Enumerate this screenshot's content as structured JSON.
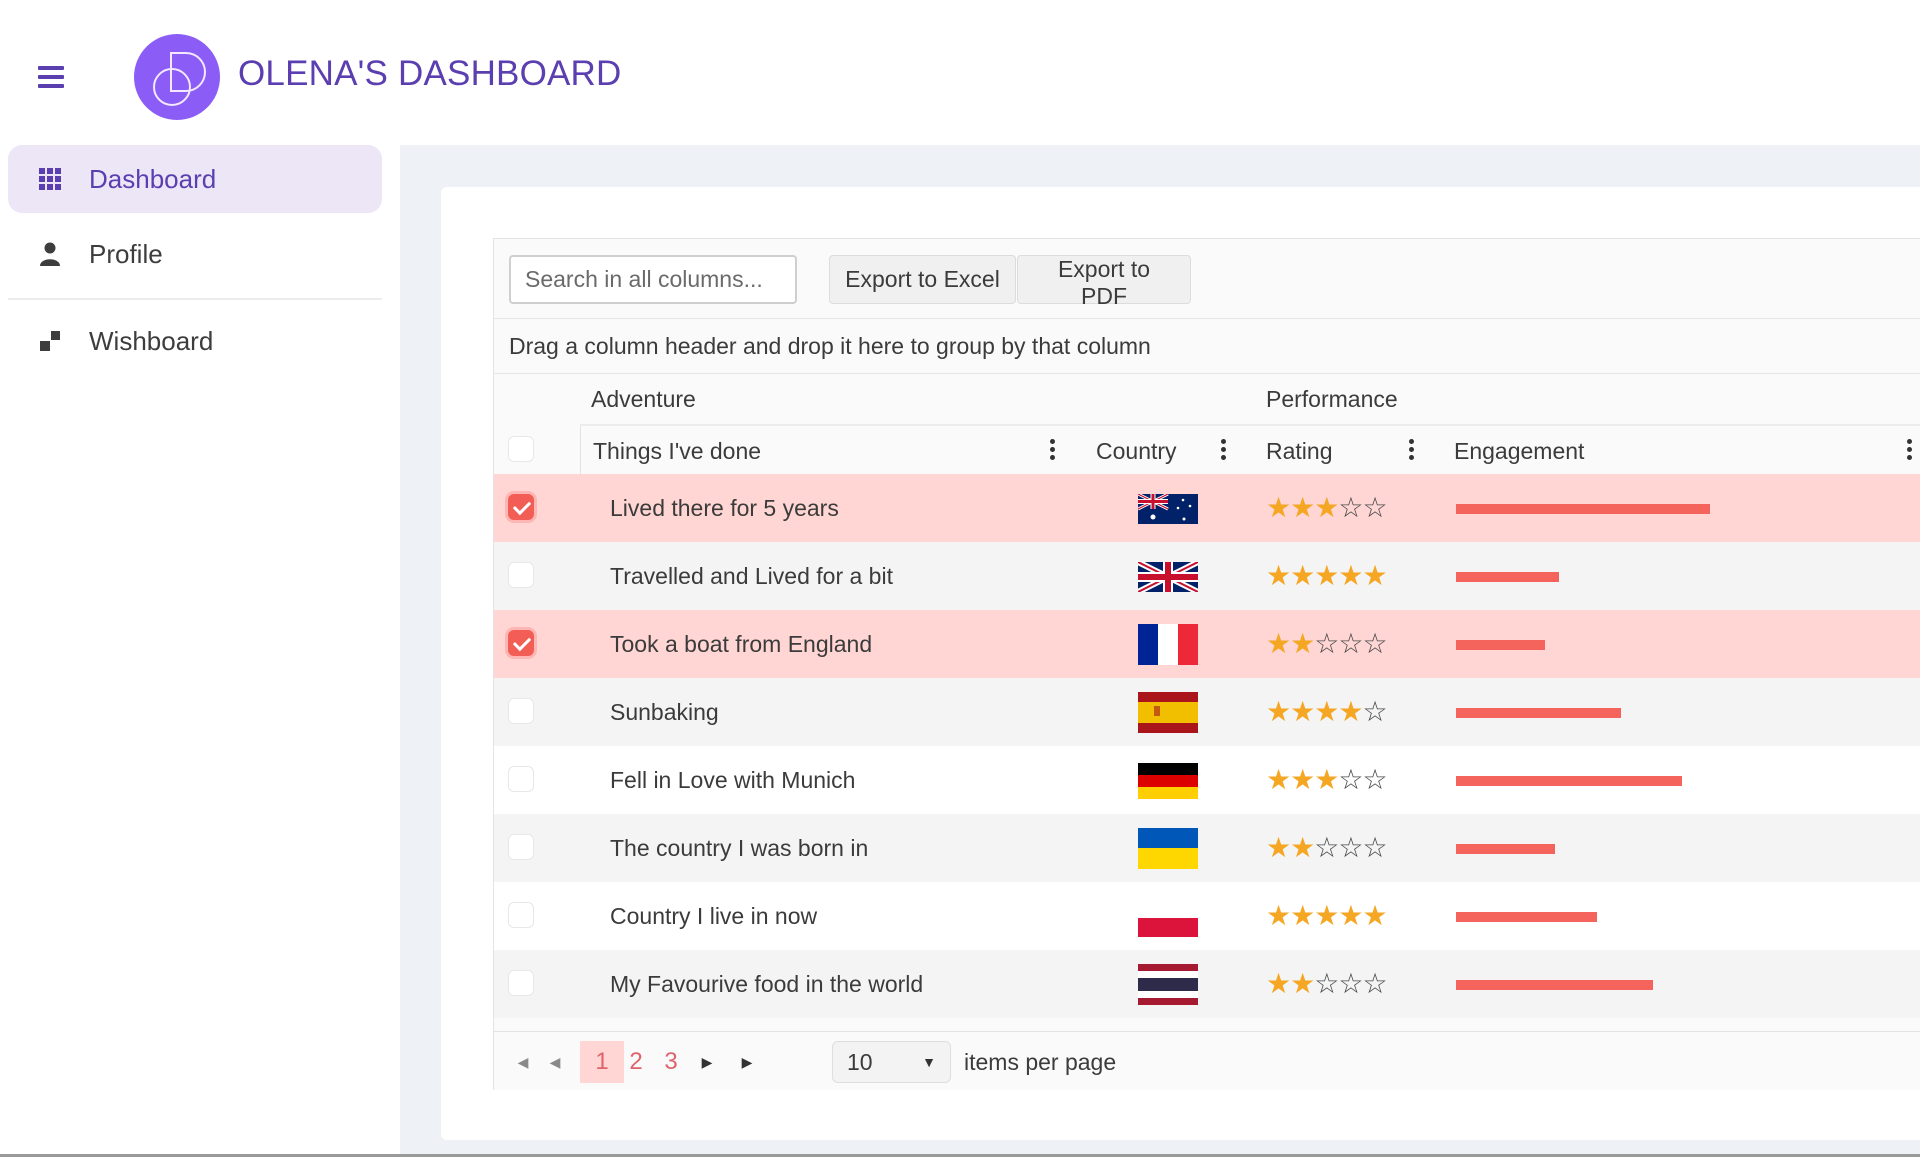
{
  "header": {
    "title": "OLENA'S DASHBOARD",
    "menu_icon": "hamburger-icon",
    "logo": "logo-interlocking-od"
  },
  "sidebar": {
    "items": [
      {
        "label": "Dashboard",
        "icon": "grid-icon",
        "active": true
      },
      {
        "label": "Profile",
        "icon": "person-icon",
        "active": false
      },
      {
        "label": "Wishboard",
        "icon": "blocks-icon",
        "active": false
      }
    ]
  },
  "colors": {
    "brand": "#5b3fb0",
    "logo": "#8b5cf6",
    "accent": "#f25d55",
    "selected_row": "#ffd6d4",
    "star": "#f5a623",
    "bar": "#f4645c"
  },
  "grid": {
    "toolbar": {
      "search_placeholder": "Search in all columns...",
      "search_value": "",
      "export_excel": "Export to Excel",
      "export_pdf": "Export to PDF"
    },
    "group_panel_text": "Drag a column header and drop it here to group by that column",
    "column_groups": [
      "Adventure",
      "Performance"
    ],
    "columns": [
      "Things I've done",
      "Country",
      "Rating",
      "Engagement"
    ],
    "rating_max": 5,
    "rows": [
      {
        "selected": true,
        "things": "Lived there for 5 years",
        "country": "Australia",
        "flag": "au",
        "rating": 3,
        "engagement": 0.54
      },
      {
        "selected": false,
        "things": "Travelled and Lived for a bit",
        "country": "United Kingdom",
        "flag": "gb",
        "rating": 5,
        "engagement": 0.22
      },
      {
        "selected": true,
        "things": "Took a boat from England",
        "country": "France",
        "flag": "fr",
        "rating": 2,
        "engagement": 0.19
      },
      {
        "selected": false,
        "things": "Sunbaking",
        "country": "Spain",
        "flag": "es",
        "rating": 4,
        "engagement": 0.35
      },
      {
        "selected": false,
        "things": "Fell in Love with Munich",
        "country": "Germany",
        "flag": "de",
        "rating": 3,
        "engagement": 0.48
      },
      {
        "selected": false,
        "things": "The country I was born in",
        "country": "Ukraine",
        "flag": "ua",
        "rating": 2,
        "engagement": 0.21
      },
      {
        "selected": false,
        "things": "Country I live in now",
        "country": "Poland",
        "flag": "pl",
        "rating": 5,
        "engagement": 0.3
      },
      {
        "selected": false,
        "things": "My Favourive food in the world",
        "country": "Thailand",
        "flag": "th",
        "rating": 2,
        "engagement": 0.42
      }
    ],
    "pager": {
      "pages": [
        "1",
        "2",
        "3"
      ],
      "current_page": "1",
      "page_size": "10",
      "items_per_page_label": "items per page"
    }
  }
}
